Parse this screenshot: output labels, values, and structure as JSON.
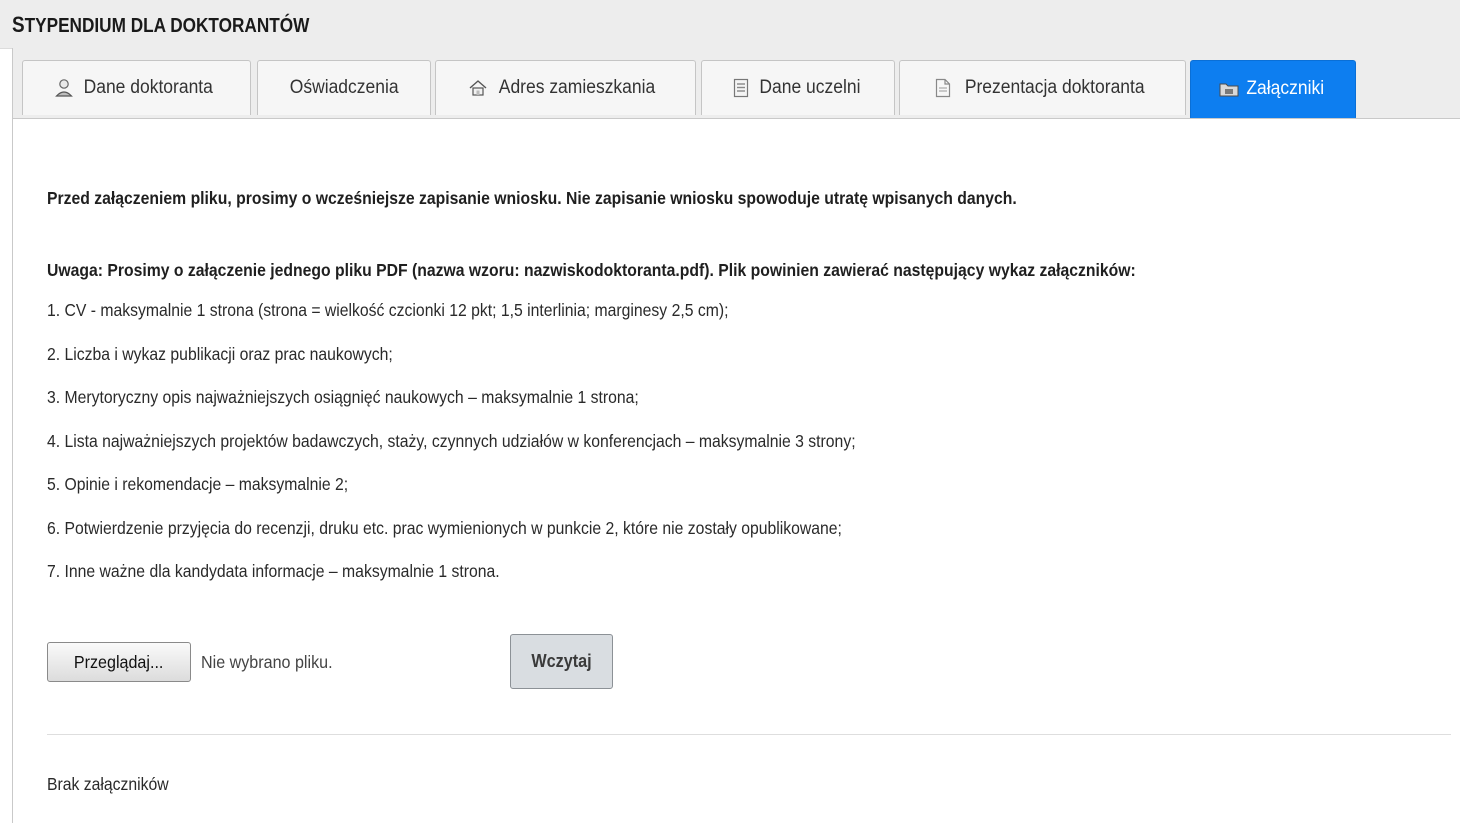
{
  "page": {
    "title_first_letter": "S",
    "title_rest": "TYPENDIUM DLA DOKTORANTÓW"
  },
  "tabs": [
    {
      "label": "Dane doktoranta",
      "icon": "user-icon",
      "active": false
    },
    {
      "label": "Oświadczenia",
      "icon": "",
      "active": false
    },
    {
      "label": "Adres zamieszkania",
      "icon": "home-icon",
      "active": false
    },
    {
      "label": "Dane uczelni",
      "icon": "document-list-icon",
      "active": false
    },
    {
      "label": "Prezentacja doktoranta",
      "icon": "document-icon",
      "active": false
    },
    {
      "label": "Załączniki",
      "icon": "attachment-folder-icon",
      "active": true
    }
  ],
  "content": {
    "save_warning": "Przed załączeniem pliku, prosimy o wcześniejsze zapisanie wniosku. Nie zapisanie wniosku spowoduje utratę wpisanych danych.",
    "notice": "Uwaga: Prosimy o załączenie jednego pliku PDF (nazwa wzoru: nazwiskodoktoranta.pdf). Plik powinien zawierać następujący wykaz załączników:",
    "requirements": [
      "1. CV - maksymalnie 1 strona (strona = wielkość czcionki 12 pkt; 1,5 interlinia; marginesy 2,5 cm);",
      "2. Liczba i wykaz publikacji oraz prac naukowych;",
      "3. Merytoryczny opis najważniejszych osiągnięć naukowych – maksymalnie 1 strona;",
      "4. Lista najważniejszych projektów badawczych, staży, czynnych udziałów w konferencjach – maksymalnie 3 strony;",
      "5. Opinie i rekomendacje – maksymalnie 2;",
      "6. Potwierdzenie przyjęcia do recenzji, druku etc. prac wymienionych w punkcie 2, które nie zostały opublikowane;",
      "7. Inne ważne dla kandydata informacje – maksymalnie 1 strona."
    ],
    "browse_label": "Przeglądaj...",
    "no_file_text": "Nie wybrano pliku.",
    "upload_label": "Wczytaj",
    "no_attachments": "Brak załączników"
  },
  "colors": {
    "active_tab": "#0d7ef0",
    "header_bg": "#ededed"
  }
}
